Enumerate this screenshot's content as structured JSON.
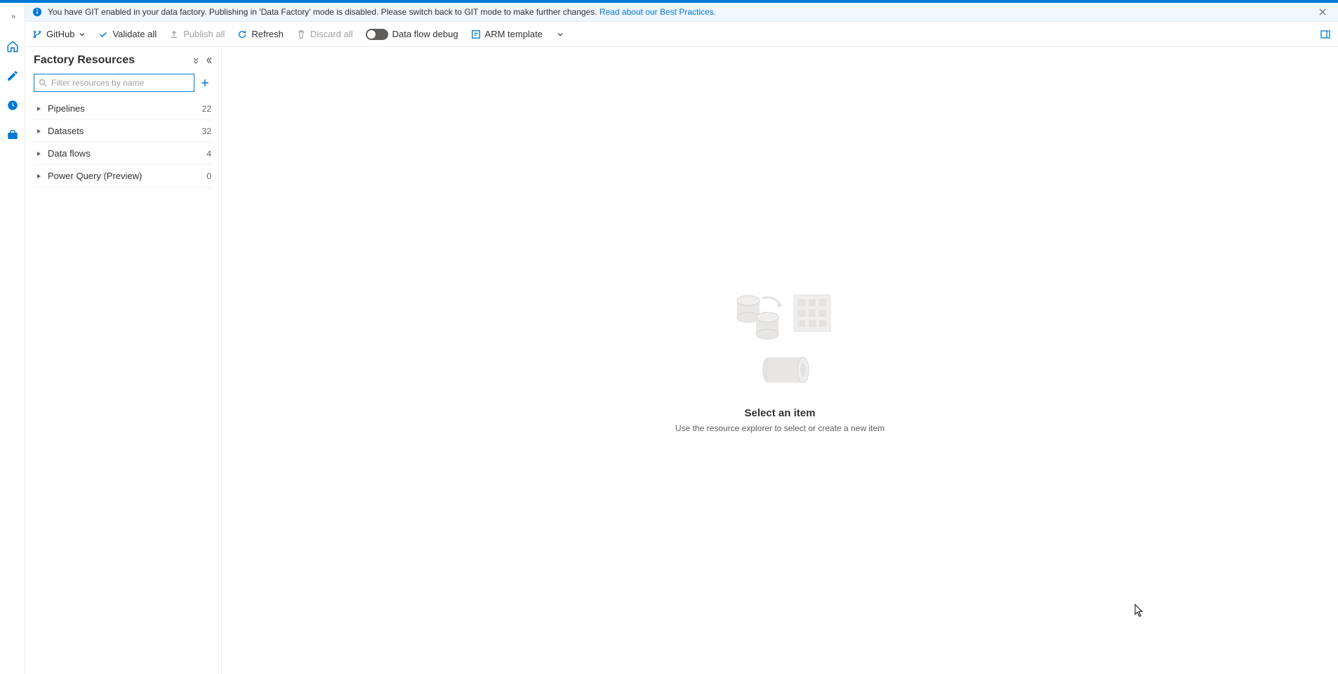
{
  "banner": {
    "text": "You have GIT enabled in your data factory. Publishing in 'Data Factory' mode is disabled. Please switch back to GIT mode to make further changes. ",
    "link": "Read about our Best Practices."
  },
  "toolbar": {
    "github": "GitHub",
    "validate": "Validate all",
    "publish": "Publish all",
    "refresh": "Refresh",
    "discard": "Discard all",
    "dataflow_debug": "Data flow debug",
    "arm_template": "ARM template"
  },
  "sidebar": {
    "title": "Factory Resources",
    "search_placeholder": "Filter resources by name",
    "items": [
      {
        "label": "Pipelines",
        "count": "22"
      },
      {
        "label": "Datasets",
        "count": "32"
      },
      {
        "label": "Data flows",
        "count": "4"
      },
      {
        "label": "Power Query (Preview)",
        "count": "0"
      }
    ]
  },
  "empty": {
    "title": "Select an item",
    "sub": "Use the resource explorer to select or create a new item"
  }
}
